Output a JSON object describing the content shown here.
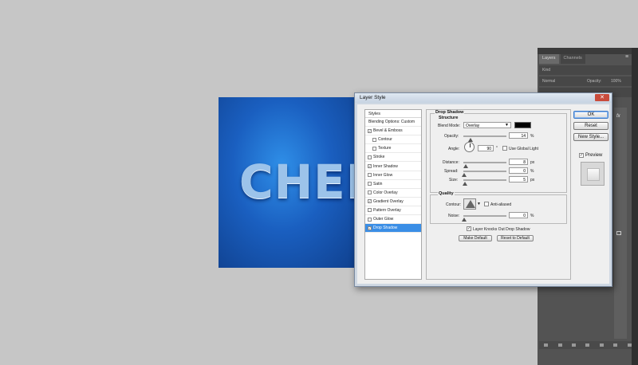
{
  "canvas": {
    "text": "CHENA"
  },
  "panels": {
    "tabs": [
      "Layers",
      "Channels"
    ],
    "menu_icon": "≡",
    "kind": "Kind",
    "blend_mode": "Normal",
    "opacity_label": "Opacity:",
    "opacity_value": "100%",
    "fx": "fx"
  },
  "dialog": {
    "title": "Layer Style",
    "close_label": "✕",
    "styles_header": "Styles",
    "style_items": [
      {
        "label": "Blending Options: Custom",
        "checkbox": false,
        "checked": false,
        "sub": false,
        "selected": false
      },
      {
        "label": "Bevel & Emboss",
        "checkbox": true,
        "checked": true,
        "sub": false,
        "selected": false
      },
      {
        "label": "Contour",
        "checkbox": true,
        "checked": false,
        "sub": true,
        "selected": false
      },
      {
        "label": "Texture",
        "checkbox": true,
        "checked": false,
        "sub": true,
        "selected": false
      },
      {
        "label": "Stroke",
        "checkbox": true,
        "checked": false,
        "sub": false,
        "selected": false
      },
      {
        "label": "Inner Shadow",
        "checkbox": true,
        "checked": true,
        "sub": false,
        "selected": false
      },
      {
        "label": "Inner Glow",
        "checkbox": true,
        "checked": false,
        "sub": false,
        "selected": false
      },
      {
        "label": "Satin",
        "checkbox": true,
        "checked": false,
        "sub": false,
        "selected": false
      },
      {
        "label": "Color Overlay",
        "checkbox": true,
        "checked": false,
        "sub": false,
        "selected": false
      },
      {
        "label": "Gradient Overlay",
        "checkbox": true,
        "checked": true,
        "sub": false,
        "selected": false
      },
      {
        "label": "Pattern Overlay",
        "checkbox": true,
        "checked": false,
        "sub": false,
        "selected": false
      },
      {
        "label": "Outer Glow",
        "checkbox": true,
        "checked": false,
        "sub": false,
        "selected": false
      },
      {
        "label": "Drop Shadow",
        "checkbox": true,
        "checked": true,
        "sub": false,
        "selected": true
      }
    ],
    "section_title": "Drop Shadow",
    "structure_title": "Structure",
    "blend_mode_label": "Blend Mode:",
    "blend_mode_value": "Overlay",
    "shadow_color": "#000000",
    "opacity_label": "Opacity:",
    "opacity_value": "14",
    "opacity_fraction": 0.14,
    "percent": "%",
    "angle_label": "Angle:",
    "angle_value": "90",
    "degree": "°",
    "global_light_label": "Use Global Light",
    "global_light_checked": false,
    "distance_label": "Distance:",
    "distance_value": "8",
    "distance_fraction": 0.03,
    "spread_label": "Spread:",
    "spread_value": "0",
    "spread_fraction": 0,
    "size_label": "Size:",
    "size_value": "5",
    "size_fraction": 0.02,
    "px": "px",
    "quality_title": "Quality",
    "contour_label": "Contour:",
    "anti_aliased_label": "Anti-aliased",
    "noise_label": "Noise:",
    "noise_value": "0",
    "noise_fraction": 0,
    "knockout_label": "Layer Knocks Out Drop Shadow",
    "knockout_checked": true,
    "make_default": "Make Default",
    "reset_default": "Reset to Default",
    "ok": "OK",
    "reset": "Reset",
    "new_style": "New Style...",
    "preview_label": "Preview",
    "preview_checked": true
  }
}
